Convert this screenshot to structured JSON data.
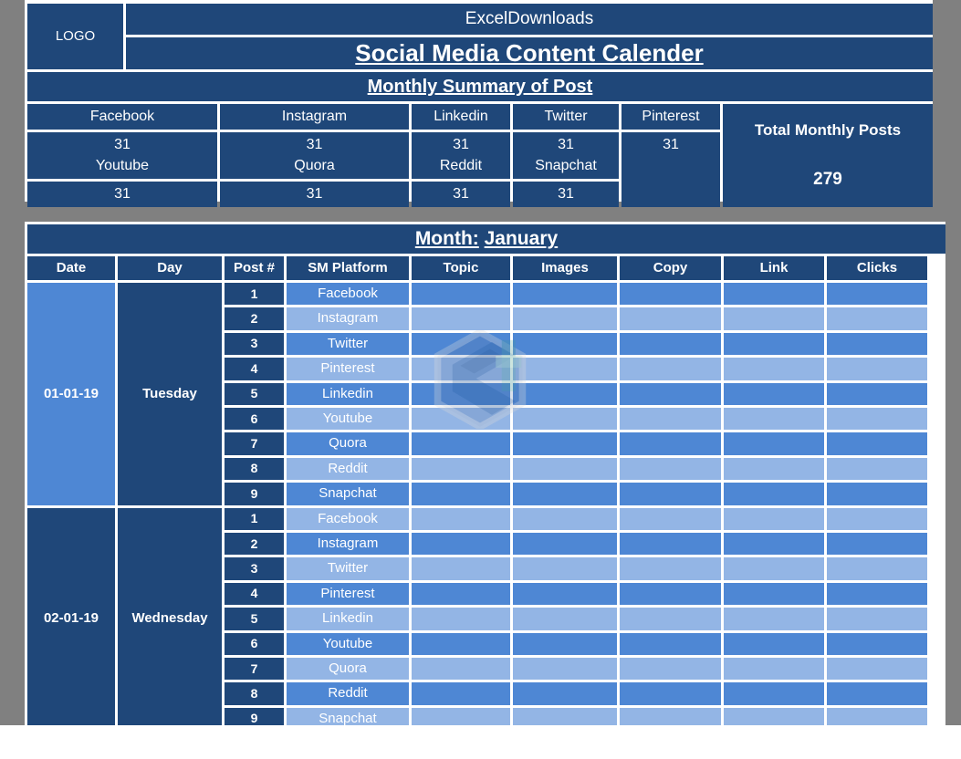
{
  "document": {
    "logo_label": "LOGO",
    "brand": "ExcelDownloads",
    "title": "Social Media Content Calender",
    "summary_title": "Monthly Summary of Post"
  },
  "summary": {
    "row1_platforms": [
      "Facebook",
      "Instagram",
      "Linkedin",
      "Twitter",
      "Pinterest"
    ],
    "row1_values": [
      "31",
      "31",
      "31",
      "31",
      "31"
    ],
    "row2_platforms": [
      "Youtube",
      "Quora",
      "Reddit",
      "Snapchat",
      ""
    ],
    "row2_values": [
      "31",
      "31",
      "31",
      "31",
      ""
    ],
    "total_label": "Total Monthly Posts",
    "total_value": "279"
  },
  "calendar": {
    "month_label": "Month:",
    "month_value": "January",
    "columns": [
      "Date",
      "Day",
      "Post #",
      "SM Platform",
      "Topic",
      "Images",
      "Copy",
      "Link",
      "Clicks"
    ],
    "blocks": [
      {
        "date": "01-01-19",
        "day": "Tuesday",
        "rows": [
          {
            "post": "1",
            "platform": "Facebook",
            "topic": "",
            "images": "",
            "copy": "",
            "link": "",
            "clicks": ""
          },
          {
            "post": "2",
            "platform": "Instagram",
            "topic": "",
            "images": "",
            "copy": "",
            "link": "",
            "clicks": ""
          },
          {
            "post": "3",
            "platform": "Twitter",
            "topic": "",
            "images": "",
            "copy": "",
            "link": "",
            "clicks": ""
          },
          {
            "post": "4",
            "platform": "Pinterest",
            "topic": "",
            "images": "",
            "copy": "",
            "link": "",
            "clicks": ""
          },
          {
            "post": "5",
            "platform": "Linkedin",
            "topic": "",
            "images": "",
            "copy": "",
            "link": "",
            "clicks": ""
          },
          {
            "post": "6",
            "platform": "Youtube",
            "topic": "",
            "images": "",
            "copy": "",
            "link": "",
            "clicks": ""
          },
          {
            "post": "7",
            "platform": "Quora",
            "topic": "",
            "images": "",
            "copy": "",
            "link": "",
            "clicks": ""
          },
          {
            "post": "8",
            "platform": "Reddit",
            "topic": "",
            "images": "",
            "copy": "",
            "link": "",
            "clicks": ""
          },
          {
            "post": "9",
            "platform": "Snapchat",
            "topic": "",
            "images": "",
            "copy": "",
            "link": "",
            "clicks": ""
          }
        ]
      },
      {
        "date": "02-01-19",
        "day": "Wednesday",
        "rows": [
          {
            "post": "1",
            "platform": "Facebook",
            "topic": "",
            "images": "",
            "copy": "",
            "link": "",
            "clicks": ""
          },
          {
            "post": "2",
            "platform": "Instagram",
            "topic": "",
            "images": "",
            "copy": "",
            "link": "",
            "clicks": ""
          },
          {
            "post": "3",
            "platform": "Twitter",
            "topic": "",
            "images": "",
            "copy": "",
            "link": "",
            "clicks": ""
          },
          {
            "post": "4",
            "platform": "Pinterest",
            "topic": "",
            "images": "",
            "copy": "",
            "link": "",
            "clicks": ""
          },
          {
            "post": "5",
            "platform": "Linkedin",
            "topic": "",
            "images": "",
            "copy": "",
            "link": "",
            "clicks": ""
          },
          {
            "post": "6",
            "platform": "Youtube",
            "topic": "",
            "images": "",
            "copy": "",
            "link": "",
            "clicks": ""
          },
          {
            "post": "7",
            "platform": "Quora",
            "topic": "",
            "images": "",
            "copy": "",
            "link": "",
            "clicks": ""
          },
          {
            "post": "8",
            "platform": "Reddit",
            "topic": "",
            "images": "",
            "copy": "",
            "link": "",
            "clicks": ""
          },
          {
            "post": "9",
            "platform": "Snapchat",
            "topic": "",
            "images": "",
            "copy": "",
            "link": "",
            "clicks": ""
          }
        ]
      }
    ]
  },
  "watermark": {
    "name": "exceldownloads-hex-e-logo"
  },
  "colors": {
    "navy": "#1f4779",
    "mid_blue": "#4e87d4",
    "light_blue": "#93b5e5",
    "frame_gray": "#808080",
    "text": "#ffffff"
  }
}
